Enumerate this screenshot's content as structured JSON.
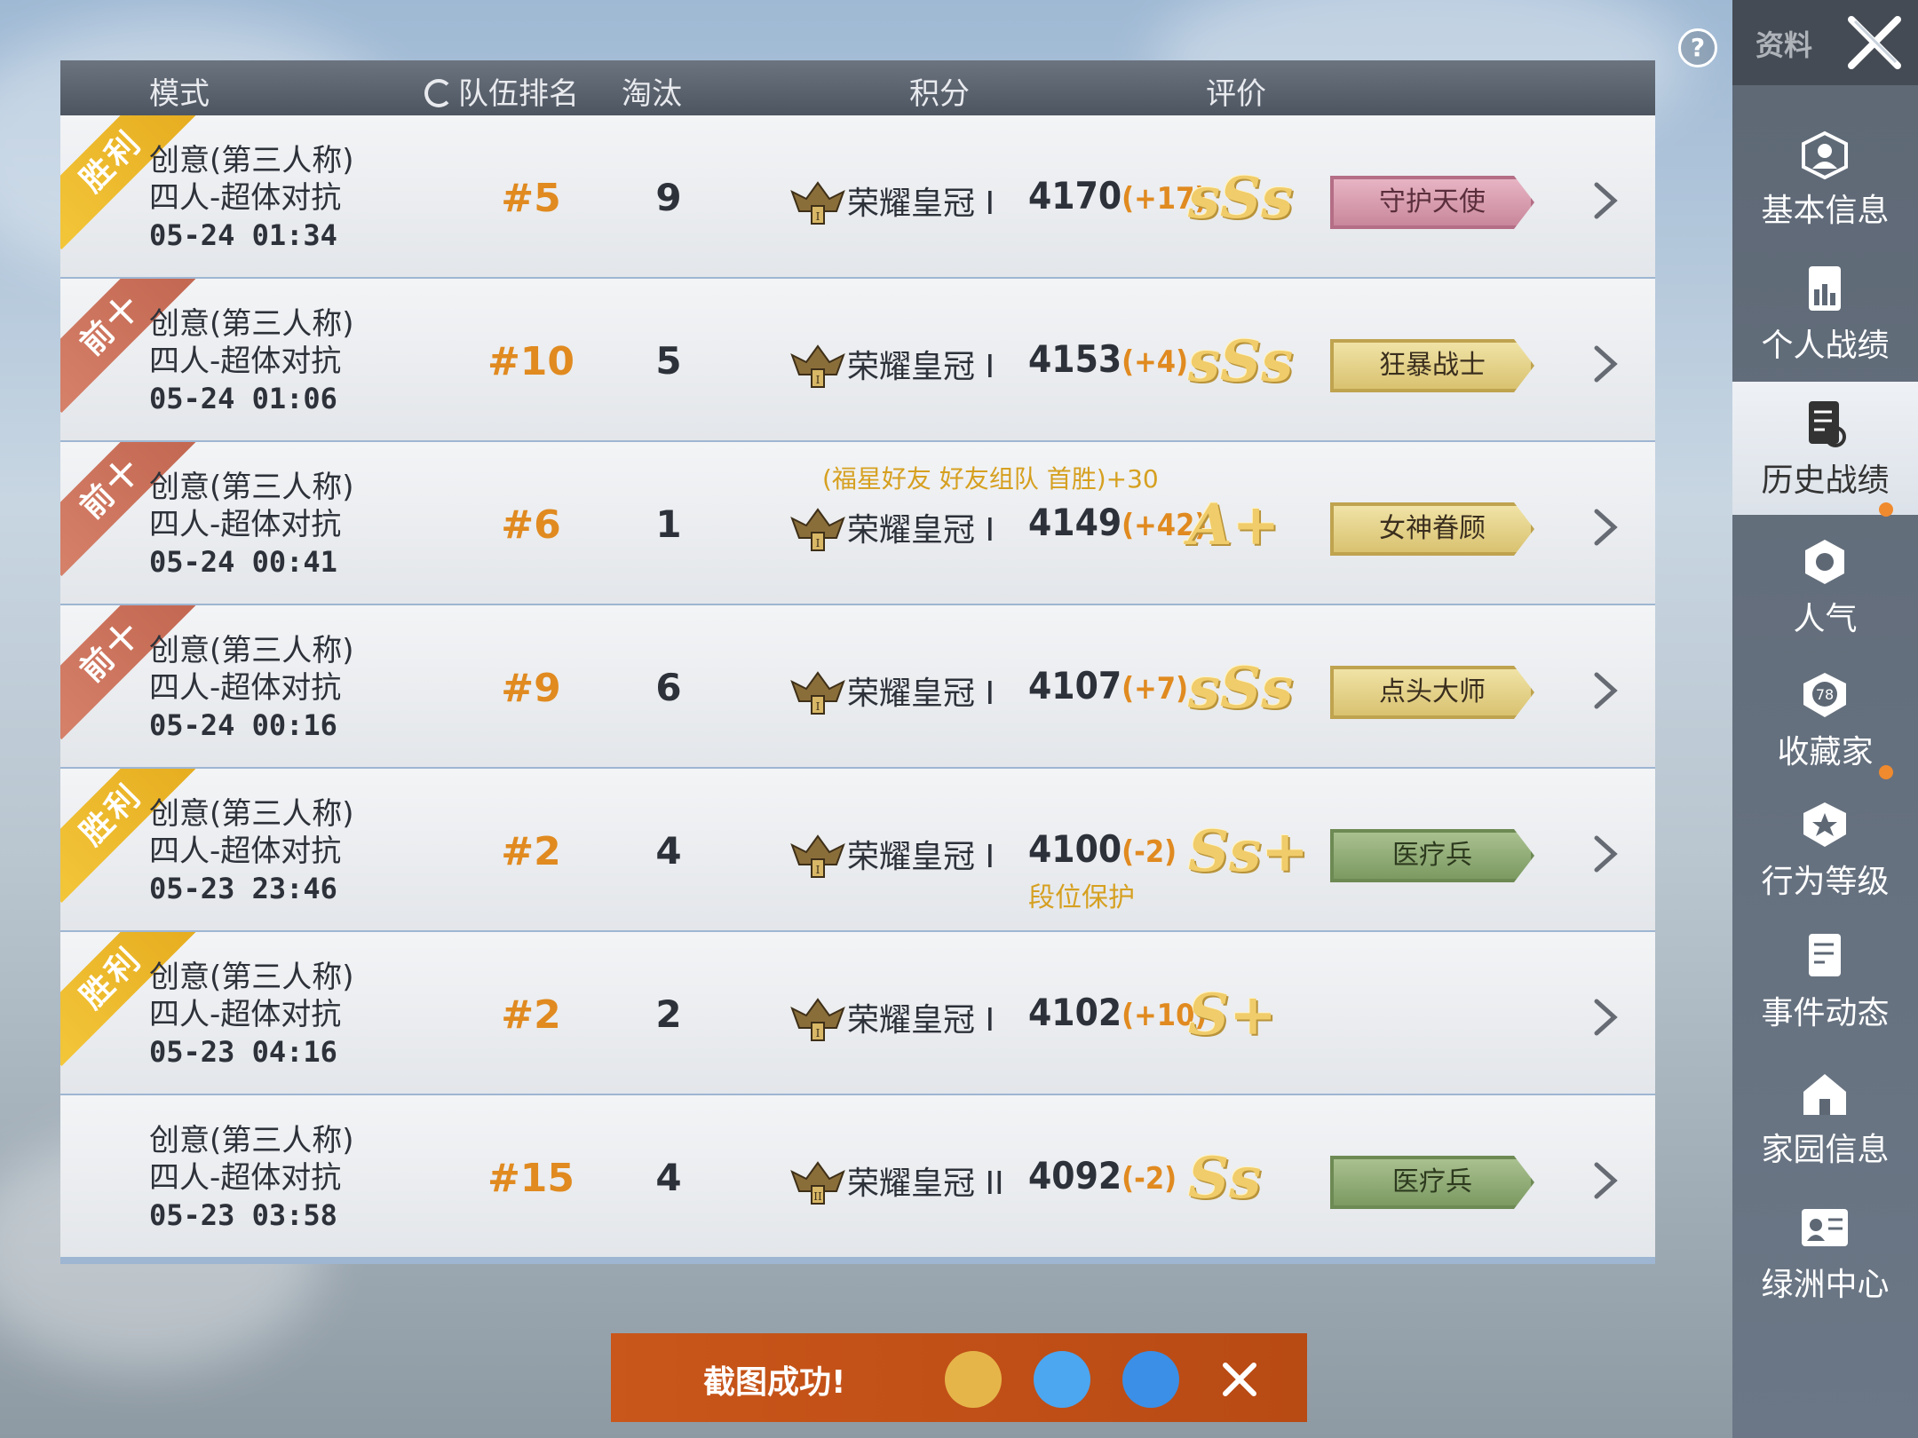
{
  "header": {
    "mode": "模式",
    "team_rank": "队伍排名",
    "kills": "淘汰",
    "score": "积分",
    "rating": "评价"
  },
  "rows": [
    {
      "result": "胜利",
      "ribbon": "win",
      "mode_line1": "创意(第三人称)",
      "mode_line2": "四人-超体对抗",
      "date": "05-24 01:34",
      "rank": "#5",
      "kills": "9",
      "tier": "荣耀皇冠 I",
      "tier_numeral": "I",
      "score": "4170",
      "delta": "(+17)",
      "bonus": "",
      "protect": "",
      "grade": "sSs",
      "title": "守护天使",
      "title_style": "pink"
    },
    {
      "result": "前十",
      "ribbon": "top10",
      "mode_line1": "创意(第三人称)",
      "mode_line2": "四人-超体对抗",
      "date": "05-24 01:06",
      "rank": "#10",
      "kills": "5",
      "tier": "荣耀皇冠 I",
      "tier_numeral": "I",
      "score": "4153",
      "delta": "(+4)",
      "bonus": "",
      "protect": "",
      "grade": "sSs",
      "title": "狂暴战士",
      "title_style": "gold"
    },
    {
      "result": "前十",
      "ribbon": "top10",
      "mode_line1": "创意(第三人称)",
      "mode_line2": "四人-超体对抗",
      "date": "05-24 00:41",
      "rank": "#6",
      "kills": "1",
      "tier": "荣耀皇冠 I",
      "tier_numeral": "I",
      "score": "4149",
      "delta": "(+42)",
      "bonus": "(福星好友 好友组队 首胜)+30",
      "protect": "",
      "grade": "A+",
      "title": "女神眷顾",
      "title_style": "gold"
    },
    {
      "result": "前十",
      "ribbon": "top10",
      "mode_line1": "创意(第三人称)",
      "mode_line2": "四人-超体对抗",
      "date": "05-24 00:16",
      "rank": "#9",
      "kills": "6",
      "tier": "荣耀皇冠 I",
      "tier_numeral": "I",
      "score": "4107",
      "delta": "(+7)",
      "bonus": "",
      "protect": "",
      "grade": "sSs",
      "title": "点头大师",
      "title_style": "gold"
    },
    {
      "result": "胜利",
      "ribbon": "win",
      "mode_line1": "创意(第三人称)",
      "mode_line2": "四人-超体对抗",
      "date": "05-23 23:46",
      "rank": "#2",
      "kills": "4",
      "tier": "荣耀皇冠 I",
      "tier_numeral": "I",
      "score": "4100",
      "delta": "(-2)",
      "bonus": "",
      "protect": "段位保护",
      "grade": "Ss+",
      "title": "医疗兵",
      "title_style": "green"
    },
    {
      "result": "胜利",
      "ribbon": "win",
      "mode_line1": "创意(第三人称)",
      "mode_line2": "四人-超体对抗",
      "date": "05-23 04:16",
      "rank": "#2",
      "kills": "2",
      "tier": "荣耀皇冠 I",
      "tier_numeral": "I",
      "score": "4102",
      "delta": "(+10)",
      "bonus": "",
      "protect": "",
      "grade": "S+",
      "title": "",
      "title_style": "none"
    },
    {
      "result": "",
      "ribbon": "none",
      "mode_line1": "创意(第三人称)",
      "mode_line2": "四人-超体对抗",
      "date": "05-23 03:58",
      "rank": "#15",
      "kills": "4",
      "tier": "荣耀皇冠 II",
      "tier_numeral": "II",
      "score": "4092",
      "delta": "(-2)",
      "bonus": "",
      "protect": "",
      "grade": "Ss",
      "title": "医疗兵",
      "title_style": "green"
    }
  ],
  "sidebar": {
    "title": "资料",
    "items": [
      {
        "label": "基本信息",
        "icon": "profile-icon"
      },
      {
        "label": "个人战绩",
        "icon": "stats-icon"
      },
      {
        "label": "历史战绩",
        "icon": "history-icon",
        "active": true
      },
      {
        "label": "人气",
        "icon": "popularity-icon",
        "badge": true
      },
      {
        "label": "收藏家",
        "icon": "collector-icon",
        "level": "78"
      },
      {
        "label": "行为等级",
        "icon": "behavior-icon",
        "badge": true
      },
      {
        "label": "事件动态",
        "icon": "events-icon"
      },
      {
        "label": "家园信息",
        "icon": "home-icon"
      },
      {
        "label": "绿洲中心",
        "icon": "oasis-icon"
      }
    ]
  },
  "toast": {
    "text": "截图成功!"
  },
  "colors": {
    "accent_orange": "#e08a20",
    "sidebar_bg": "#5e6875",
    "toast_bg": "#c9561a"
  }
}
